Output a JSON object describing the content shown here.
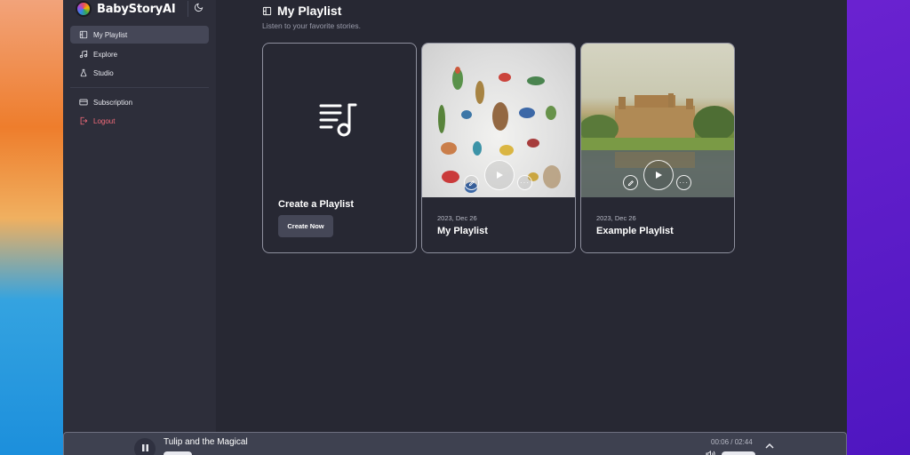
{
  "app": {
    "brand_name": "BabyStoryAI"
  },
  "sidebar": {
    "items": [
      {
        "label": "My Playlist",
        "icon": "playlist-icon",
        "active": true
      },
      {
        "label": "Explore",
        "icon": "music-note-icon",
        "active": false
      },
      {
        "label": "Studio",
        "icon": "flask-icon",
        "active": false
      },
      {
        "label": "Subscription",
        "icon": "credit-card-icon",
        "active": false
      },
      {
        "label": "Logout",
        "icon": "logout-icon",
        "active": false
      }
    ]
  },
  "main": {
    "title": "My Playlist",
    "subtitle": "Listen to your favorite stories.",
    "create_card": {
      "title": "Create a Playlist",
      "button_label": "Create Now"
    },
    "playlists": [
      {
        "date": "2023, Dec 26",
        "title": "My Playlist",
        "cover": "birds-illustration"
      },
      {
        "date": "2023, Dec 26",
        "title": "Example Playlist",
        "cover": "castle-lake-painting"
      }
    ]
  },
  "player": {
    "track_title": "Tulip and the Magical",
    "time": "00:06 / 02:44"
  },
  "colors": {
    "background": "#272833",
    "sidebar": "#2d2e3a",
    "active_item": "#454757",
    "logout": "#f26b7a",
    "player": "#3e4150"
  }
}
